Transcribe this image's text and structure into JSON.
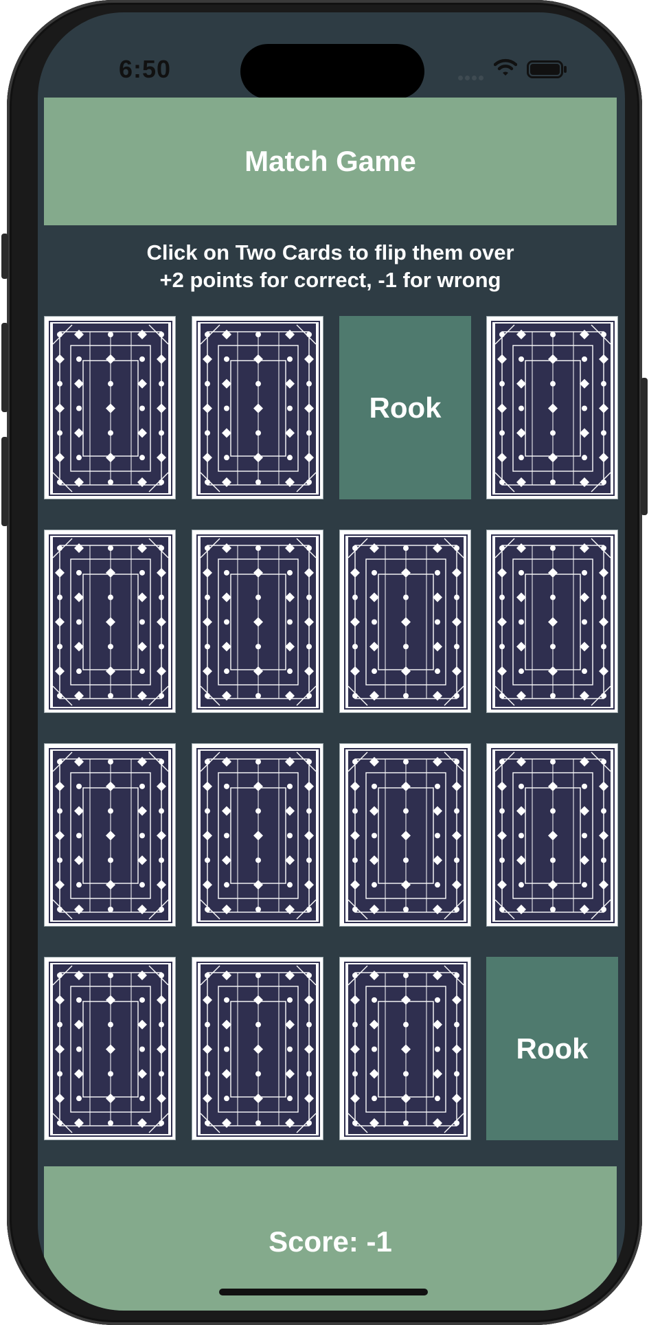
{
  "status_bar": {
    "time": "6:50",
    "wifi_icon": "wifi-icon",
    "battery_icon": "battery-icon"
  },
  "header": {
    "title": "Match Game"
  },
  "instructions": {
    "line1": "Click on Two Cards to flip them over",
    "line2": "+2 points for correct, -1 for wrong"
  },
  "board": {
    "rows": 4,
    "columns": 4,
    "cards": [
      {
        "state": "face-down",
        "label": ""
      },
      {
        "state": "face-down",
        "label": ""
      },
      {
        "state": "face-up",
        "label": "Rook"
      },
      {
        "state": "face-down",
        "label": ""
      },
      {
        "state": "face-down",
        "label": ""
      },
      {
        "state": "face-down",
        "label": ""
      },
      {
        "state": "face-down",
        "label": ""
      },
      {
        "state": "face-down",
        "label": ""
      },
      {
        "state": "face-down",
        "label": ""
      },
      {
        "state": "face-down",
        "label": ""
      },
      {
        "state": "face-down",
        "label": ""
      },
      {
        "state": "face-down",
        "label": ""
      },
      {
        "state": "face-down",
        "label": ""
      },
      {
        "state": "face-down",
        "label": ""
      },
      {
        "state": "face-down",
        "label": ""
      },
      {
        "state": "face-up",
        "label": "Rook"
      }
    ]
  },
  "footer": {
    "score_text": "Score: -1"
  },
  "colors": {
    "background": "#2e3c44",
    "band": "#84aa8c",
    "card_face": "#4f7a6e",
    "card_back_pattern": "#2f2f4f",
    "text": "#ffffff"
  }
}
